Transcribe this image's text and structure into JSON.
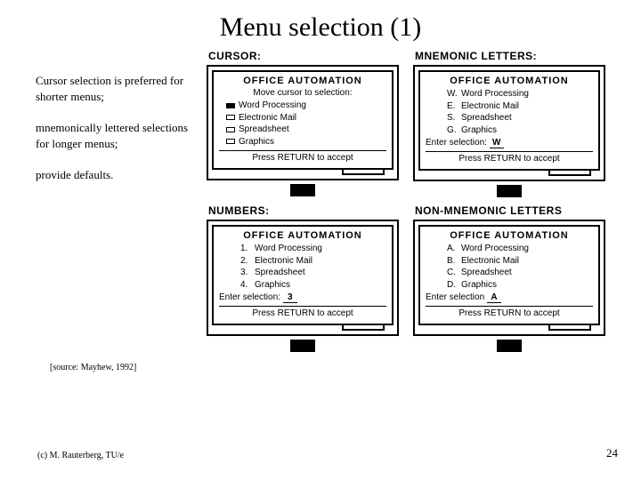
{
  "title": "Menu selection (1)",
  "left_text": {
    "p1": "Cursor selection is preferred for shorter menus;",
    "p2": "mnemonically lettered selections for longer menus;",
    "p3": "provide defaults."
  },
  "panels": {
    "cursor": {
      "label": "CURSOR:",
      "screen_title": "OFFICE AUTOMATION",
      "instruction": "Move cursor to selection:",
      "items": [
        "Word Processing",
        "Electronic Mail",
        "Spreadsheet",
        "Graphics"
      ],
      "selected_index": 0,
      "press": "Press RETURN to accept"
    },
    "mnemonic": {
      "label": "MNEMONIC LETTERS:",
      "screen_title": "OFFICE AUTOMATION",
      "items": [
        {
          "prefix": "W.",
          "text": "Word Processing"
        },
        {
          "prefix": "E.",
          "text": "Electronic Mail"
        },
        {
          "prefix": "S.",
          "text": "Spreadsheet"
        },
        {
          "prefix": "G.",
          "text": "Graphics"
        }
      ],
      "enter_label": "Enter selection:",
      "enter_value": "W",
      "press": "Press RETURN to accept"
    },
    "numbers": {
      "label": "NUMBERS:",
      "screen_title": "OFFICE AUTOMATION",
      "items": [
        {
          "prefix": "1.",
          "text": "Word Processing"
        },
        {
          "prefix": "2.",
          "text": "Electronic Mail"
        },
        {
          "prefix": "3.",
          "text": "Spreadsheet"
        },
        {
          "prefix": "4.",
          "text": "Graphics"
        }
      ],
      "enter_label": "Enter selection:",
      "enter_value": "3",
      "press": "Press RETURN to accept"
    },
    "nonmnemonic": {
      "label": "NON-MNEMONIC LETTERS",
      "screen_title": "OFFICE AUTOMATION",
      "items": [
        {
          "prefix": "A.",
          "text": "Word Processing"
        },
        {
          "prefix": "B.",
          "text": "Electronic Mail"
        },
        {
          "prefix": "C.",
          "text": "Spreadsheet"
        },
        {
          "prefix": "D.",
          "text": "Graphics"
        }
      ],
      "enter_label": "Enter selection",
      "enter_value": "A",
      "press": "Press RETURN to accept"
    }
  },
  "source": "[source: Mayhew, 1992]",
  "copyright": "(c) M. Rauterberg, TU/e",
  "page_number": "24"
}
